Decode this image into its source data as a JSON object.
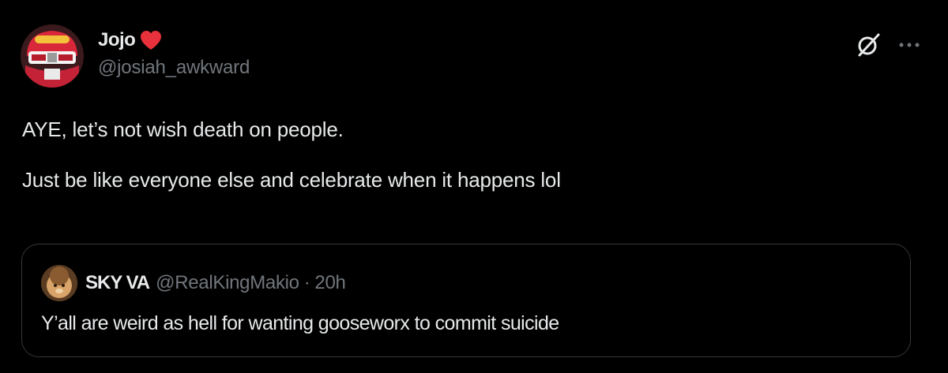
{
  "tweet": {
    "author": {
      "display_name": "Jojo",
      "badge_icon": "heart-icon",
      "handle": "@josiah_awkward",
      "avatar_icon": "avatar"
    },
    "actions": {
      "grok_icon": "grok-icon",
      "more_icon": "more-icon"
    },
    "text": {
      "line1": "AYE, let’s not wish death on people.",
      "line2": "Just be like everyone else and celebrate when it happens lol"
    },
    "quote": {
      "display_name": "SKY VA",
      "handle": "@RealKingMakio",
      "separator": "·",
      "time": "20h",
      "text": "Y’all are weird as hell for wanting gooseworx to commit suicide"
    }
  },
  "colors": {
    "background": "#000000",
    "primary_text": "#e7e9ea",
    "secondary_text": "#71767b",
    "border": "#333639",
    "heart": "#f91880"
  }
}
